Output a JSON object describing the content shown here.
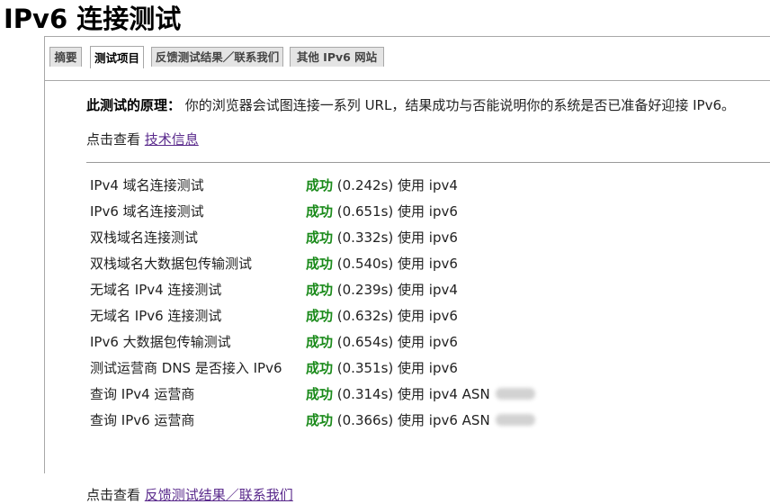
{
  "page": {
    "title": "IPv6 连接测试"
  },
  "tabs": [
    {
      "label": "摘要",
      "active": false
    },
    {
      "label": "测试项目",
      "active": true
    },
    {
      "label": "反馈测试结果／联系我们",
      "active": false
    },
    {
      "label": "其他 IPv6 网站",
      "active": false
    }
  ],
  "intro": {
    "principle_label": "此测试的原理：",
    "principle_text": "你的浏览器会试图连接一系列 URL，结果成功与否能说明你的系统是否已准备好迎接 IPv6。",
    "techinfo_prefix": "点击查看 ",
    "techinfo_link": "技术信息"
  },
  "results": [
    {
      "name": "IPv4 域名连接测试",
      "status": "成功",
      "detail": " (0.242s) 使用 ipv4",
      "asn": false
    },
    {
      "name": "IPv6 域名连接测试",
      "status": "成功",
      "detail": " (0.651s) 使用 ipv6",
      "asn": false
    },
    {
      "name": "双栈域名连接测试",
      "status": "成功",
      "detail": " (0.332s) 使用 ipv6",
      "asn": false
    },
    {
      "name": "双栈域名大数据包传输测试",
      "status": "成功",
      "detail": " (0.540s) 使用 ipv6",
      "asn": false
    },
    {
      "name": "无域名 IPv4 连接测试",
      "status": "成功",
      "detail": " (0.239s) 使用 ipv4",
      "asn": false
    },
    {
      "name": "无域名 IPv6 连接测试",
      "status": "成功",
      "detail": " (0.632s) 使用 ipv6",
      "asn": false
    },
    {
      "name": "IPv6 大数据包传输测试",
      "status": "成功",
      "detail": " (0.654s) 使用 ipv6",
      "asn": false
    },
    {
      "name": "测试运营商 DNS 是否接入 IPv6",
      "status": "成功",
      "detail": " (0.351s) 使用 ipv6",
      "asn": false
    },
    {
      "name": "查询 IPv4 运营商",
      "status": "成功",
      "detail": " (0.314s) 使用 ipv4 ASN",
      "asn": true
    },
    {
      "name": "查询 IPv6 运营商",
      "status": "成功",
      "detail": " (0.366s) 使用 ipv6 ASN",
      "asn": true
    }
  ],
  "footer": {
    "feedback_prefix": "点击查看 ",
    "feedback_link": "反馈测试结果／联系我们"
  },
  "colors": {
    "success": "#1a8a1a",
    "link": "#5a2a8c",
    "border": "#a8a8a8"
  }
}
